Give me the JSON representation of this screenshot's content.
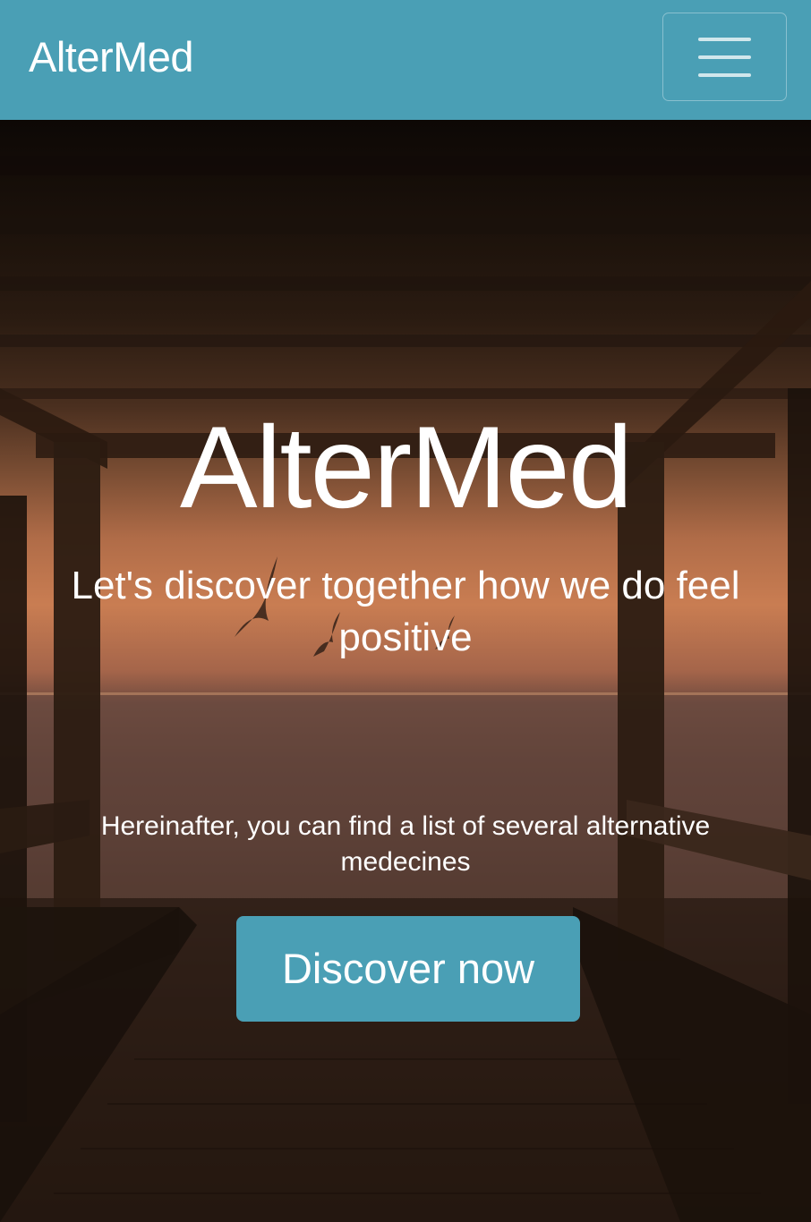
{
  "colors": {
    "primary": "#4a9fb5",
    "text_on_primary": "#ffffff"
  },
  "navbar": {
    "brand": "AlterMed",
    "toggler_icon": "hamburger-menu-icon"
  },
  "hero": {
    "title": "AlterMed",
    "subtitle": "Let's discover together how we do feel positive",
    "description": "Hereinafter, you can find a list of several alternative medecines",
    "cta_label": "Discover now"
  }
}
